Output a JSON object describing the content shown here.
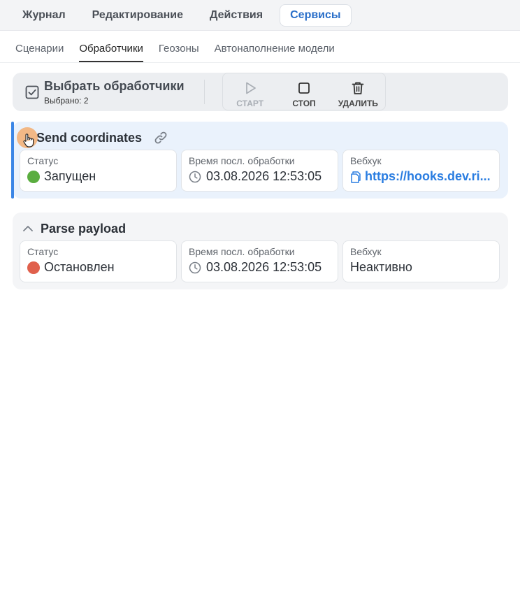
{
  "top_tabs": [
    {
      "label": "Журнал",
      "active": false
    },
    {
      "label": "Редактирование",
      "active": false
    },
    {
      "label": "Действия",
      "active": false
    },
    {
      "label": "Сервисы",
      "active": true
    }
  ],
  "sub_tabs": [
    {
      "label": "Сценарии",
      "active": false
    },
    {
      "label": "Обработчики",
      "active": true
    },
    {
      "label": "Геозоны",
      "active": false
    },
    {
      "label": "Автонаполнение модели",
      "active": false
    }
  ],
  "toolbar": {
    "select_title": "Выбрать обработчики",
    "selected_count": "Выбрано: 2",
    "start_label": "СТАРТ",
    "stop_label": "СТОП",
    "delete_label": "УДАЛИТЬ"
  },
  "handlers": [
    {
      "title": "Send coordinates",
      "selected": true,
      "status_label": "Статус",
      "status_value": "Запущен",
      "status_color": "#5aad3f",
      "time_label": "Время посл. обработки",
      "time_value": "03.08.2026 12:53:05",
      "webhook_label": "Вебхук",
      "webhook_value": "https://hooks.dev.ri..."
    },
    {
      "title": "Parse payload",
      "selected": false,
      "status_label": "Статус",
      "status_value": "Остановлен",
      "status_color": "#e0604c",
      "time_label": "Время посл. обработки",
      "time_value": "03.08.2026 12:53:05",
      "webhook_label": "Вебхук",
      "webhook_value": "Неактивно"
    }
  ],
  "colors": {
    "accent": "#2a6fc9",
    "link": "#2a7de1",
    "selected_bar": "#3b86e6"
  }
}
